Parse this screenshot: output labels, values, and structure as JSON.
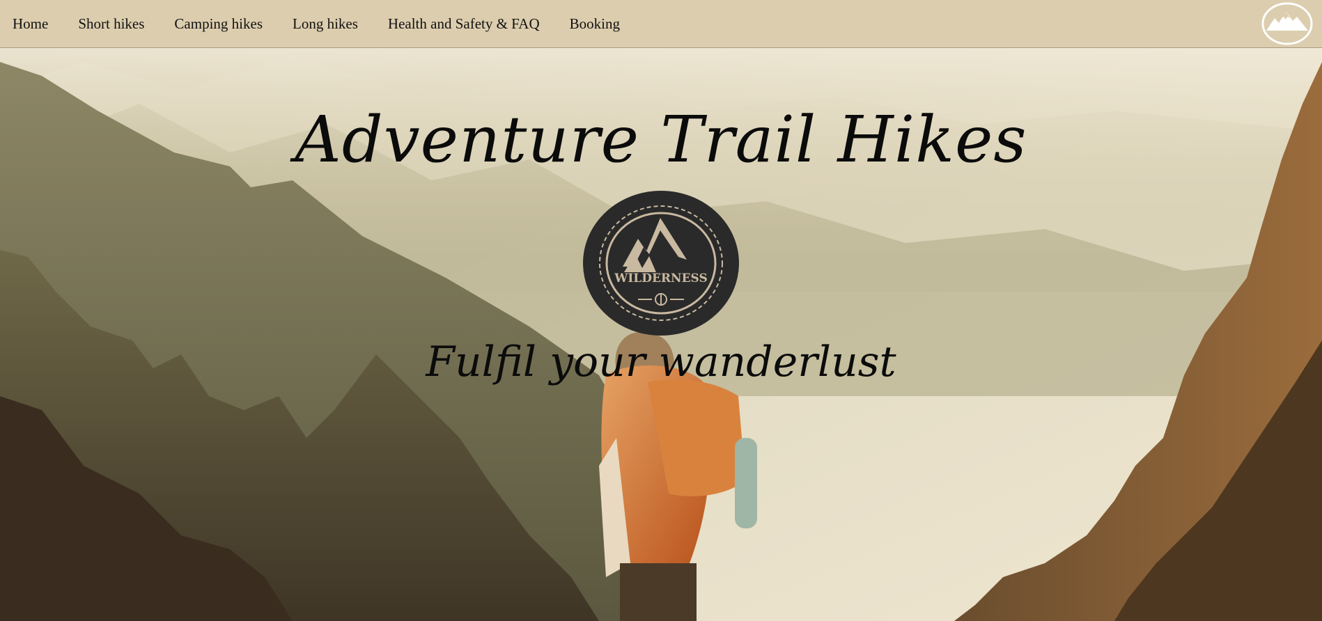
{
  "nav": {
    "links": [
      "Home",
      "Short hikes",
      "Camping hikes",
      "Long hikes",
      "Health and Safety & FAQ",
      "Booking"
    ],
    "logo_icon": "mountain-logo-icon"
  },
  "hero": {
    "title": "Adventure Trail Hikes",
    "badge_text": "WILDERNESS",
    "badge_icon": "wilderness-badge-icon",
    "tagline": "Fulfil your wanderlust",
    "background": "hiker-mountain-background"
  },
  "colors": {
    "nav_bg": "#dccdae",
    "text": "#111111",
    "badge_bg": "#2a2a2a",
    "badge_accent": "#c9b9a0"
  }
}
